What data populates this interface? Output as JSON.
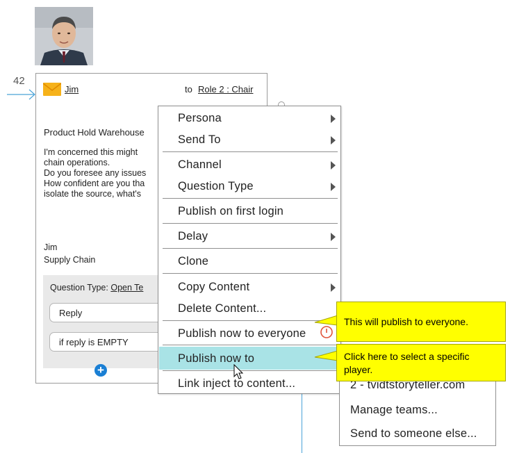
{
  "step_number": "42",
  "message": {
    "sender": "Jim",
    "to_label": "to",
    "recipient": "Role 2 : Chair",
    "subject": "Product Hold Warehouse",
    "body_lines": [
      "I'm concerned this might",
      "chain operations.",
      "Do you foresee any issues",
      "How confident are you tha",
      "isolate the source, what's"
    ],
    "signature_name": "Jim",
    "signature_role": "Supply Chain",
    "question_type_label": "Question Type:",
    "question_type_value": "Open Te",
    "reply_option": "Reply",
    "empty_option": "if reply is EMPTY",
    "add_symbol": "+"
  },
  "context_menu": {
    "items": [
      {
        "label": "Persona",
        "has_submenu": true
      },
      {
        "label": "Send To",
        "has_submenu": true
      },
      {
        "label": "Channel",
        "has_submenu": true
      },
      {
        "label": "Question Type",
        "has_submenu": true
      },
      {
        "label": "Publish on first login",
        "has_submenu": false
      },
      {
        "label": "Delay",
        "has_submenu": true
      },
      {
        "label": "Clone",
        "has_submenu": false
      },
      {
        "label": "Copy Content",
        "has_submenu": true
      },
      {
        "label": "Delete Content...",
        "has_submenu": false
      },
      {
        "label": "Publish now to everyone",
        "has_submenu": false
      },
      {
        "label": "Publish now to",
        "has_submenu": true,
        "highlighted": true
      },
      {
        "label": "Link inject to content...",
        "has_submenu": false
      }
    ]
  },
  "submenu": {
    "items": [
      {
        "label": "2 - tvidtstoryteller.com"
      },
      {
        "label": "Manage teams..."
      },
      {
        "label": "Send to someone else..."
      }
    ]
  },
  "callouts": {
    "everyone": "This will publish to everyone.",
    "specific": "Click here to select a specific player."
  },
  "colors": {
    "highlight": "#a9e3e6",
    "callout": "#ffff00",
    "accent_blue": "#1a7fd4",
    "connector": "#4aa3d8"
  },
  "icons": {
    "mail": "envelope-icon",
    "add": "plus-circle-icon",
    "cursor": "mouse-pointer-icon",
    "submenu": "chevron-right-icon"
  }
}
